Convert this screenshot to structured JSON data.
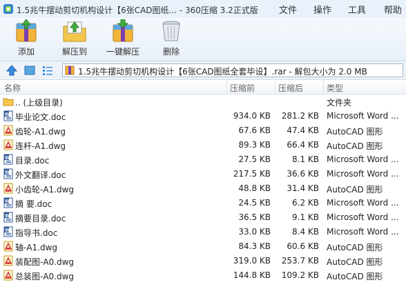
{
  "window": {
    "title": "1.5兆牛摆动剪切机构设计【6张CAD图纸... - 360压缩 3.2正式版"
  },
  "menu": {
    "file": "文件",
    "operate": "操作",
    "tools": "工具",
    "help": "帮助"
  },
  "toolbar": {
    "add": "添加",
    "extract": "解压到",
    "oneclick": "一键解压",
    "delete": "删除"
  },
  "address": {
    "path": "1.5兆牛摆动剪切机构设计【6张CAD图纸全套毕设】.rar - 解包大小为 2.0 MB"
  },
  "columns": {
    "name": "名称",
    "size": "压缩前",
    "packed": "压缩后",
    "type": "类型"
  },
  "files": [
    {
      "name": ".. (上级目录)",
      "size": "",
      "packed": "",
      "type": "文件夹",
      "icon": "folder"
    },
    {
      "name": "毕业论文.doc",
      "size": "934.0 KB",
      "packed": "281.2 KB",
      "type": "Microsoft Word ...",
      "icon": "word"
    },
    {
      "name": "齿轮-A1.dwg",
      "size": "67.6 KB",
      "packed": "47.4 KB",
      "type": "AutoCAD 图形",
      "icon": "dwg"
    },
    {
      "name": "连杆-A1.dwg",
      "size": "89.3 KB",
      "packed": "66.4 KB",
      "type": "AutoCAD 图形",
      "icon": "dwg"
    },
    {
      "name": "目录.doc",
      "size": "27.5 KB",
      "packed": "8.1 KB",
      "type": "Microsoft Word ...",
      "icon": "word"
    },
    {
      "name": "外文翻译.doc",
      "size": "217.5 KB",
      "packed": "36.6 KB",
      "type": "Microsoft Word ...",
      "icon": "word"
    },
    {
      "name": "小齿轮-A1.dwg",
      "size": "48.8 KB",
      "packed": "31.4 KB",
      "type": "AutoCAD 图形",
      "icon": "dwg"
    },
    {
      "name": "摘 要.doc",
      "size": "24.5 KB",
      "packed": "6.2 KB",
      "type": "Microsoft Word ...",
      "icon": "word"
    },
    {
      "name": "摘要目录.doc",
      "size": "36.5 KB",
      "packed": "9.1 KB",
      "type": "Microsoft Word ...",
      "icon": "word"
    },
    {
      "name": "指导书.doc",
      "size": "33.0 KB",
      "packed": "8.4 KB",
      "type": "Microsoft Word ...",
      "icon": "word"
    },
    {
      "name": "轴-A1.dwg",
      "size": "84.3 KB",
      "packed": "60.6 KB",
      "type": "AutoCAD 图形",
      "icon": "dwg"
    },
    {
      "name": "装配图-A0.dwg",
      "size": "319.0 KB",
      "packed": "253.7 KB",
      "type": "AutoCAD 图形",
      "icon": "dwg"
    },
    {
      "name": "总装图-A0.dwg",
      "size": "144.8 KB",
      "packed": "109.2 KB",
      "type": "AutoCAD 图形",
      "icon": "dwg"
    }
  ]
}
